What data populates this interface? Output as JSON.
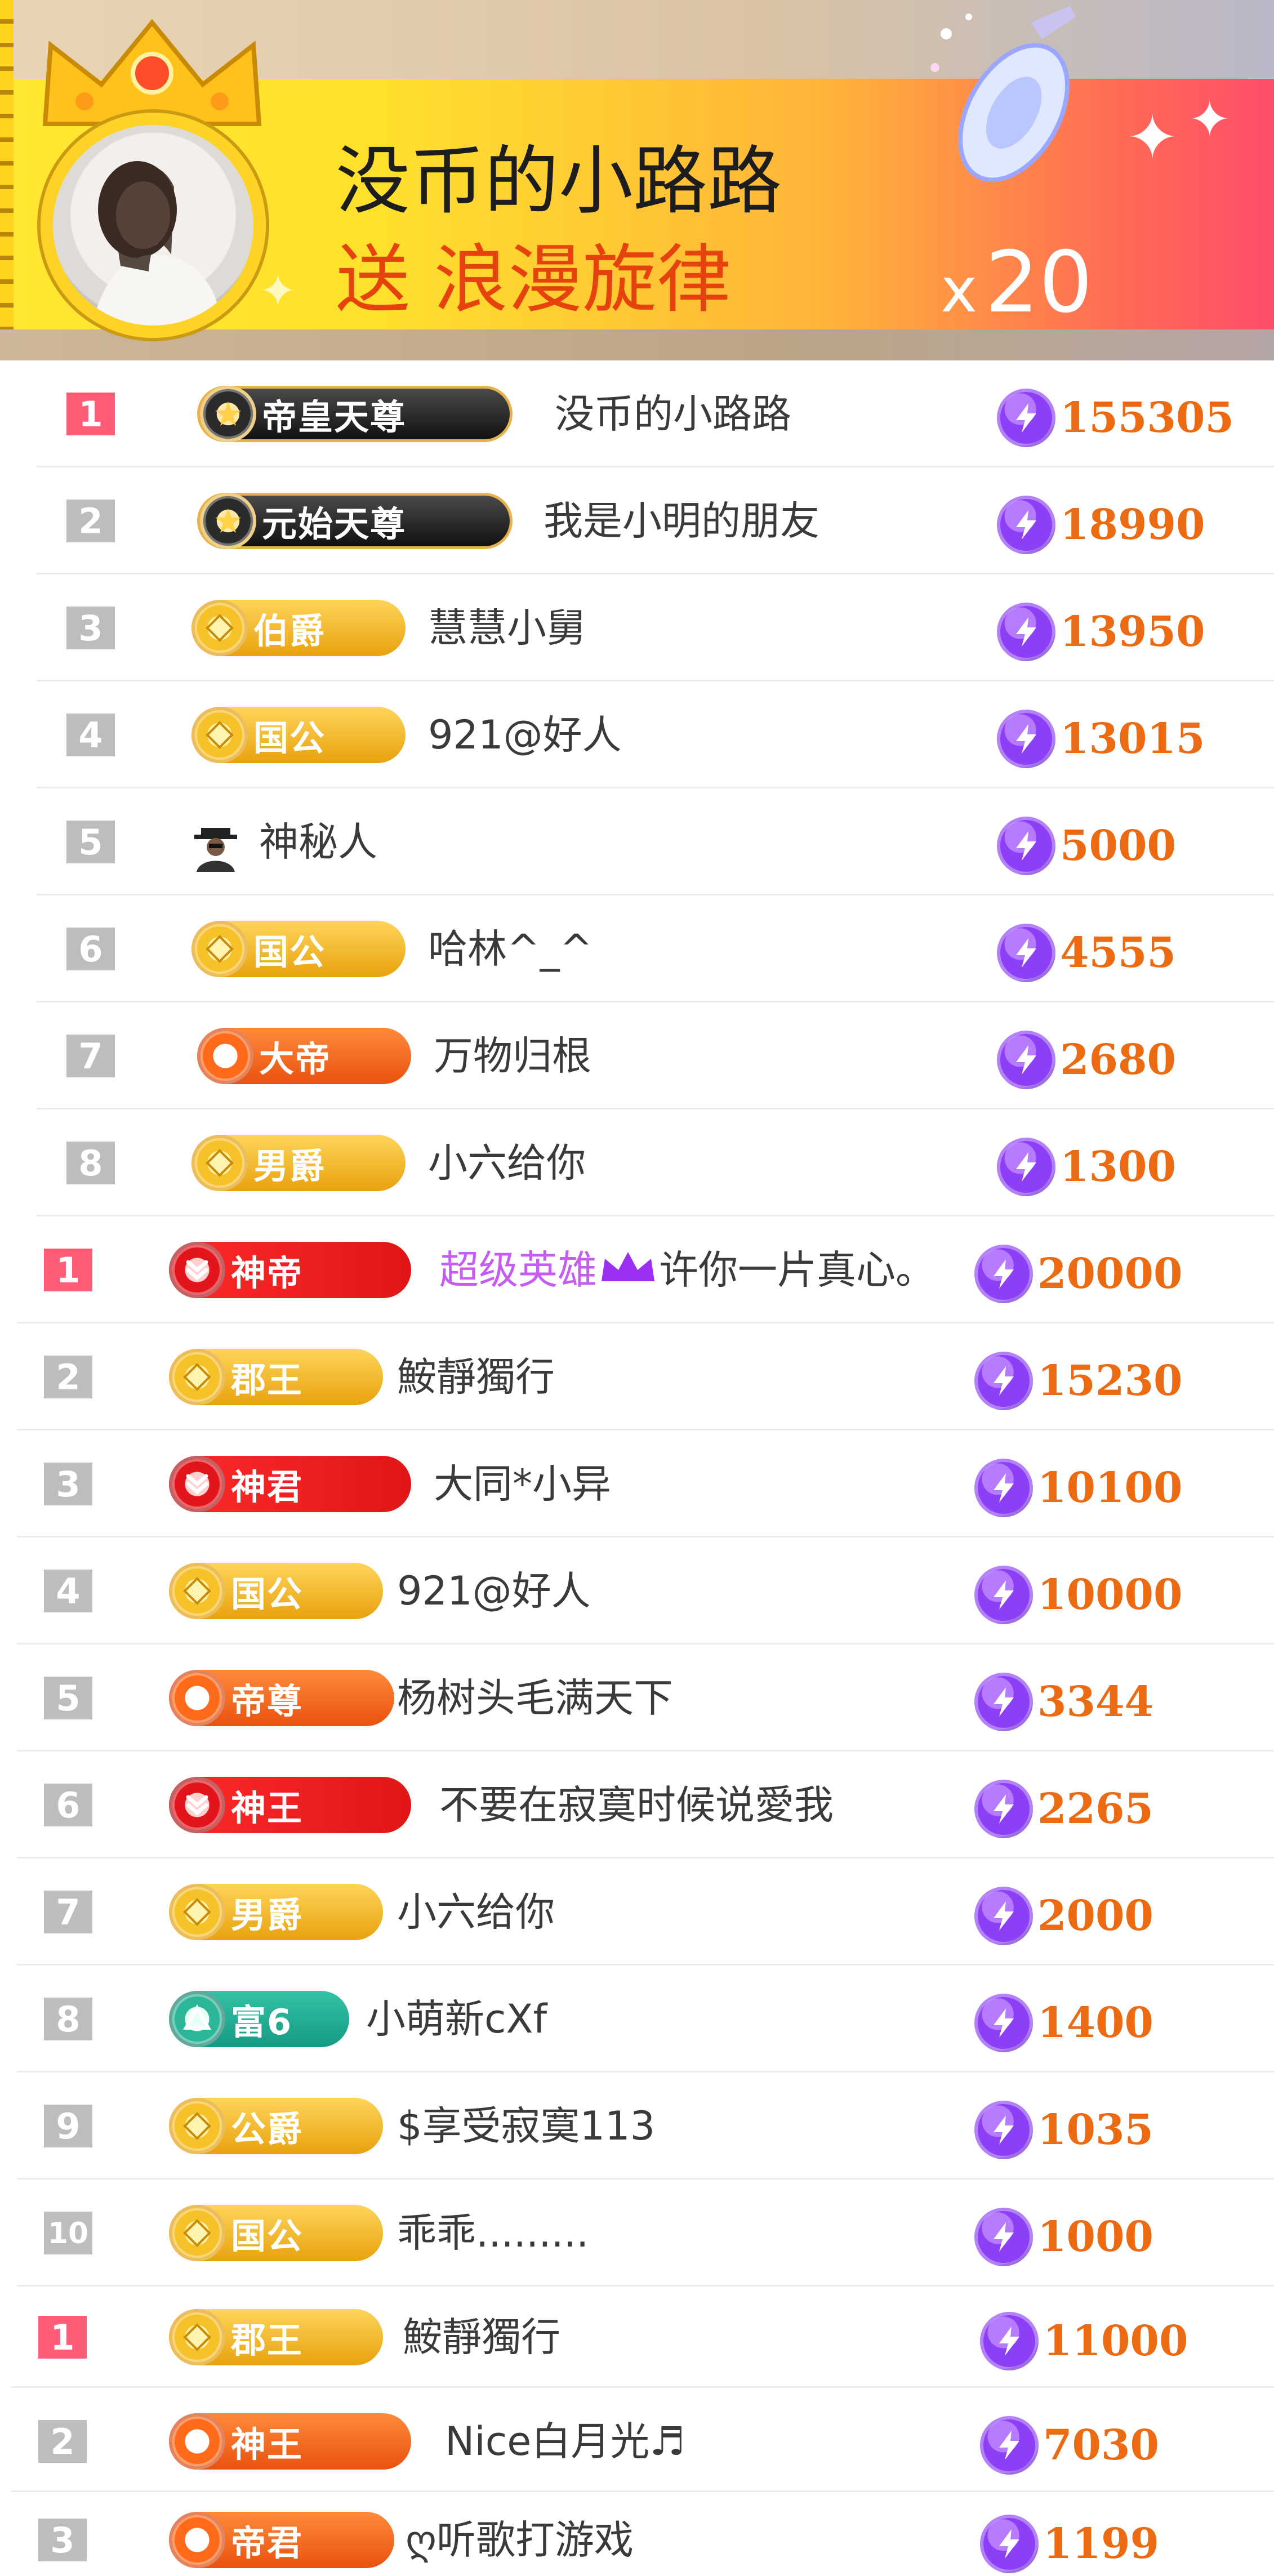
{
  "banner": {
    "sender_name": "没币的小路路",
    "gift_text": "送 浪漫旋律",
    "gift_count_prefix": "x",
    "gift_count": "20"
  },
  "rows": [
    {
      "rank": "1",
      "first": true,
      "badge": {
        "style": "dark",
        "label": "帝皇天尊"
      },
      "name": "没币的小路路",
      "amount": "155305"
    },
    {
      "rank": "2",
      "badge": {
        "style": "dark",
        "label": "元始天尊"
      },
      "name": "我是小明的朋友",
      "amount": "18990"
    },
    {
      "rank": "3",
      "badge": {
        "style": "gold",
        "label": "伯爵"
      },
      "name": "慧慧小舅",
      "amount": "13950"
    },
    {
      "rank": "4",
      "badge": {
        "style": "gold",
        "label": "国公"
      },
      "name": "921@好人",
      "amount": "13015"
    },
    {
      "rank": "5",
      "badge": null,
      "name": "神秘人",
      "amount": "5000"
    },
    {
      "rank": "6",
      "badge": {
        "style": "gold",
        "label": "国公"
      },
      "name": "哈林^_^",
      "amount": "4555"
    },
    {
      "rank": "7",
      "badge": {
        "style": "orange",
        "label": "大帝"
      },
      "name": "万物归根",
      "amount": "2680"
    },
    {
      "rank": "8",
      "badge": {
        "style": "gold",
        "label": "男爵"
      },
      "name": "小六给你",
      "amount": "1300"
    },
    {
      "rank": "1",
      "first": true,
      "badge": {
        "style": "red",
        "label": "神帝"
      },
      "name": "超级英雄",
      "name_rest": "许你一片真心。",
      "amount": "20000"
    },
    {
      "rank": "2",
      "badge": {
        "style": "gold",
        "label": "郡王"
      },
      "name": "鮟靜獨行",
      "amount": "15230"
    },
    {
      "rank": "3",
      "badge": {
        "style": "red",
        "label": "神君"
      },
      "name": "大同*小异",
      "amount": "10100"
    },
    {
      "rank": "4",
      "badge": {
        "style": "gold",
        "label": "国公"
      },
      "name": "921@好人",
      "amount": "10000"
    },
    {
      "rank": "5",
      "badge": {
        "style": "orange",
        "label": "帝尊"
      },
      "name": "杨树头毛满天下",
      "amount": "3344"
    },
    {
      "rank": "6",
      "badge": {
        "style": "red",
        "label": "神王"
      },
      "name": "不要在寂寞时候说愛我",
      "amount": "2265"
    },
    {
      "rank": "7",
      "badge": {
        "style": "gold",
        "label": "男爵"
      },
      "name": "小六给你",
      "amount": "2000"
    },
    {
      "rank": "8",
      "badge": {
        "style": "teal",
        "label": "富6"
      },
      "name": "小萌新cXf",
      "amount": "1400"
    },
    {
      "rank": "9",
      "badge": {
        "style": "gold",
        "label": "公爵"
      },
      "name": "$享受寂寞113",
      "amount": "1035"
    },
    {
      "rank": "10",
      "badge": {
        "style": "gold",
        "label": "国公"
      },
      "name": "乖乖.........",
      "amount": "1000"
    },
    {
      "rank": "1",
      "first": true,
      "badge": {
        "style": "gold",
        "label": "郡王"
      },
      "name": "鮟靜獨行",
      "amount": "11000"
    },
    {
      "rank": "2",
      "badge": {
        "style": "orange",
        "label": "神王"
      },
      "name": "Nice白月光♬",
      "amount": "7030"
    },
    {
      "rank": "3",
      "badge": {
        "style": "orange",
        "label": "帝君"
      },
      "name": "ღ听歌打游戏",
      "amount": "1199"
    }
  ],
  "colors": {
    "rank_first": "#ff5d77",
    "rank_default": "#bdbdbd",
    "amount_text": "#ec6a12",
    "coin": "#8d3ff5",
    "highlight_name": "#c55cf3"
  }
}
